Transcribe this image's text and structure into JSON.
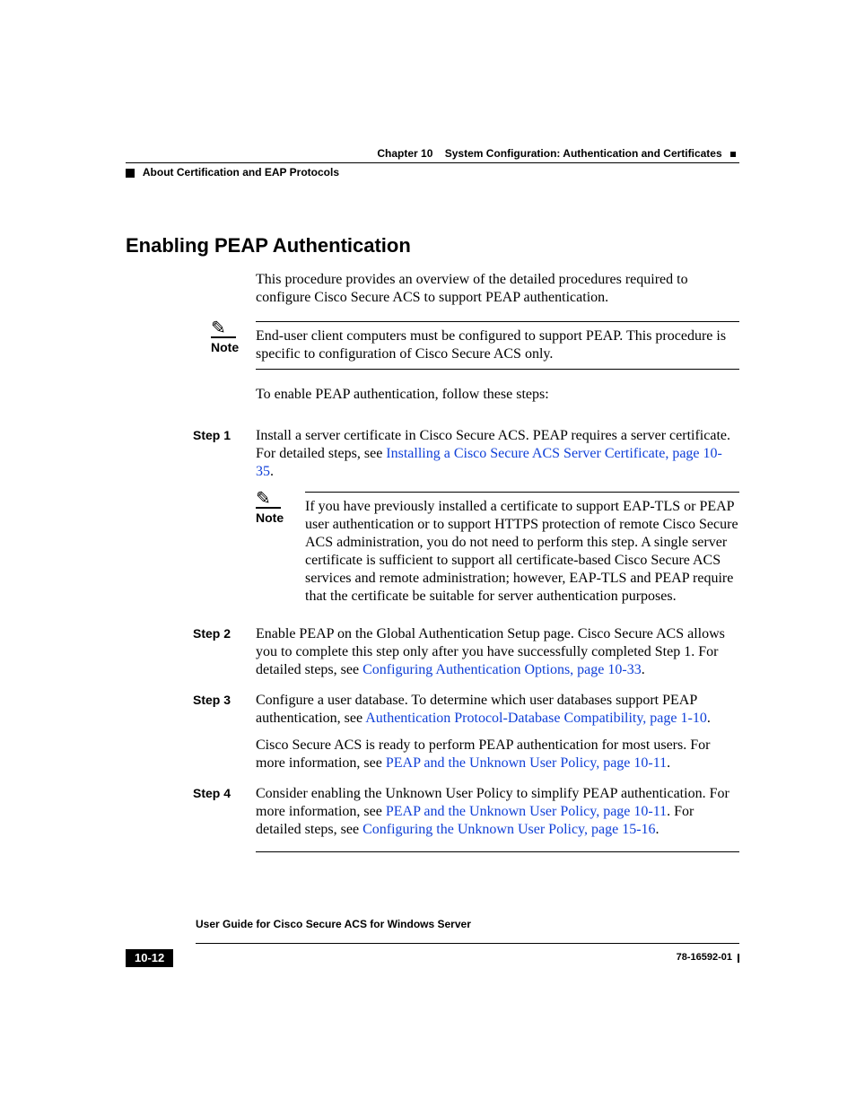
{
  "runningHeader": {
    "chapterLabel": "Chapter 10",
    "chapterTitle": "System Configuration: Authentication and Certificates",
    "sectionBreadcrumb": "About Certification and EAP Protocols"
  },
  "heading": "Enabling PEAP Authentication",
  "intro": "This procedure provides an overview of the detailed procedures required to configure Cisco Secure ACS to support PEAP authentication.",
  "note1": {
    "label": "Note",
    "text": "End-user client computers must be configured to support PEAP. This procedure is specific to configuration of Cisco Secure ACS only."
  },
  "lead": "To enable PEAP authentication, follow these steps:",
  "steps": {
    "s1": {
      "label": "Step 1",
      "pre": "Install a server certificate in Cisco Secure ACS. PEAP requires a server certificate. For detailed steps, see ",
      "link": "Installing a Cisco Secure ACS Server Certificate, page 10-35",
      "post": ".",
      "note": {
        "label": "Note",
        "text": "If you have previously installed a certificate to support EAP-TLS or PEAP user authentication or to support HTTPS protection of remote Cisco Secure ACS administration, you do not need to perform this step. A single server certificate is sufficient to support all certificate-based Cisco Secure ACS services and remote administration; however, EAP-TLS and PEAP require that the certificate be suitable for server authentication purposes."
      }
    },
    "s2": {
      "label": "Step 2",
      "pre": "Enable PEAP on the Global Authentication Setup page. Cisco Secure ACS allows you to complete this step only after you have successfully completed Step 1. For detailed steps, see ",
      "link": "Configuring Authentication Options, page 10-33",
      "post": "."
    },
    "s3": {
      "label": "Step 3",
      "pre": "Configure a user database. To determine which user databases support PEAP authentication, see ",
      "link": "Authentication Protocol-Database Compatibility, page 1-10",
      "post": ".",
      "follow_pre": "Cisco Secure ACS is ready to perform PEAP authentication for most users. For more information, see ",
      "follow_link": "PEAP and the Unknown User Policy, page 10-11",
      "follow_post": "."
    },
    "s4": {
      "label": "Step 4",
      "pre": "Consider enabling the Unknown User Policy to simplify PEAP authentication. For more information, see ",
      "link": "PEAP and the Unknown User Policy, page 10-11",
      "mid": ". For detailed steps, see ",
      "link2": "Configuring the Unknown User Policy, page 15-16",
      "post": "."
    }
  },
  "footer": {
    "guide": "User Guide for Cisco Secure ACS for Windows Server",
    "page": "10-12",
    "doc": "78-16592-01"
  }
}
